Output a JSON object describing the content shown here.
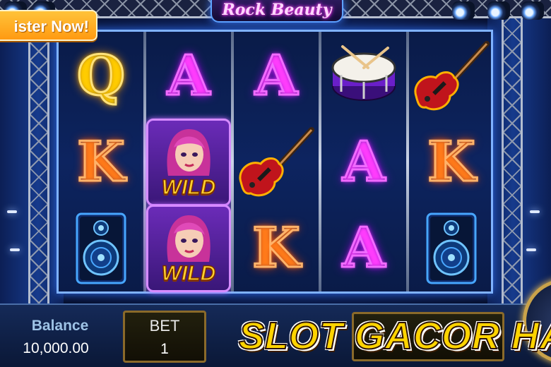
{
  "game": {
    "title": "Rock Beauty"
  },
  "register_button": {
    "label": "ister Now!"
  },
  "reels": [
    [
      "Q",
      "K",
      "speaker"
    ],
    [
      "A",
      "wild",
      "wild"
    ],
    [
      "A",
      "guitar",
      "K"
    ],
    [
      "drum",
      "A",
      "A"
    ],
    [
      "guitar",
      "K",
      "speaker"
    ]
  ],
  "wild_label": "WILD",
  "bottom_bar": {
    "balance_label": "Balance",
    "balance_value": "10,000.00",
    "bet_label": "BET",
    "bet_value": "1"
  },
  "promo_text": "SLOT GACOR HARI I",
  "colors": {
    "letter_A": "#f16bff",
    "letter_K": "#ffb36a",
    "letter_Q": "#ffe27a",
    "wild_text": "#ffd22e",
    "promo": "#ffd400"
  }
}
